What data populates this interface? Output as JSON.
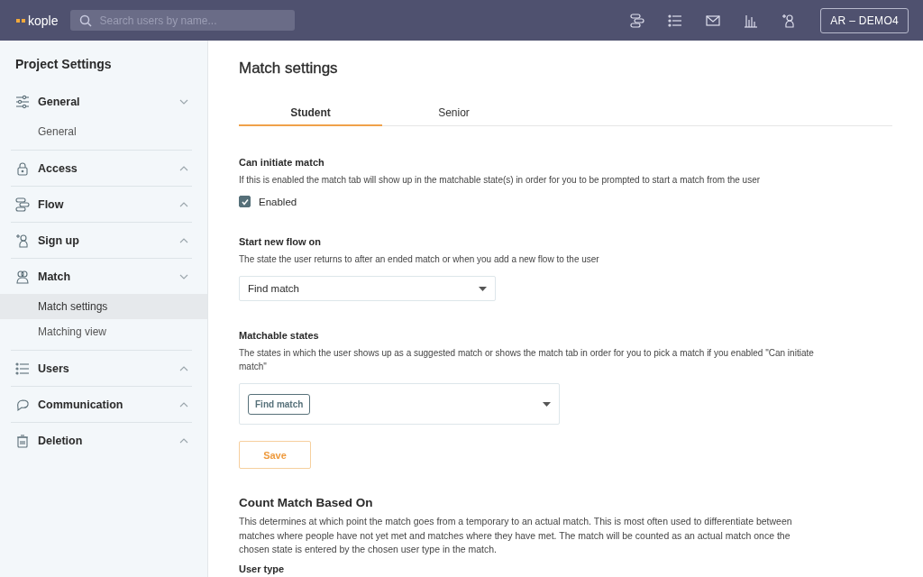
{
  "topbar": {
    "logo": "kople",
    "search": {
      "placeholder": "Search users by name..."
    },
    "icons": [
      {
        "kind": "flow"
      },
      {
        "kind": "list"
      },
      {
        "kind": "mail"
      },
      {
        "kind": "chart"
      },
      {
        "kind": "signup"
      }
    ],
    "account": "AR – DEMO4"
  },
  "sidebar": {
    "title": "Project Settings",
    "sections": [
      {
        "label": "General",
        "kind": "sliders",
        "expanded": true,
        "children": [
          {
            "label": "General",
            "selected": false
          }
        ]
      },
      {
        "label": "Access",
        "kind": "lock",
        "expanded": false
      },
      {
        "label": "Flow",
        "kind": "flow",
        "expanded": false
      },
      {
        "label": "Sign up",
        "kind": "signup",
        "expanded": false
      },
      {
        "label": "Match",
        "kind": "match",
        "expanded": true,
        "children": [
          {
            "label": "Match settings",
            "selected": true
          },
          {
            "label": "Matching view",
            "selected": false
          }
        ]
      },
      {
        "label": "Users",
        "kind": "list",
        "expanded": false
      },
      {
        "label": "Communication",
        "kind": "chat",
        "expanded": false
      },
      {
        "label": "Deletion",
        "kind": "trash",
        "expanded": false
      }
    ]
  },
  "main": {
    "title": "Match settings",
    "tabs": [
      {
        "label": "Student",
        "selected": true
      },
      {
        "label": "Senior",
        "selected": false
      }
    ],
    "can_initiate": {
      "title": "Can initiate match",
      "description": "If this is enabled the match tab will show up in the matchable state(s) in order for you to be prompted to start a match from the user",
      "checkbox": {
        "label": "Enabled",
        "checked": true
      }
    },
    "start_flow": {
      "title": "Start new flow on",
      "description": "The state the user returns to after an ended match or when you add a new flow to the user",
      "value": "Find match"
    },
    "matchable": {
      "title": "Matchable states",
      "description": "The states in which the user shows up as a suggested match or shows the match tab in order for you to pick a match if you enabled \"Can initiate match\"",
      "tags": [
        "Find match"
      ]
    },
    "save": "Save",
    "count": {
      "title": "Count Match Based On",
      "description": "This determines at which point the match goes from a temporary to an actual match. This is most often used to differentiate between matches where people have not yet met and matches where they have met. The match will be counted as an actual match once the chosen state is entered by the chosen user type in the match.",
      "next_label": "User type"
    }
  }
}
